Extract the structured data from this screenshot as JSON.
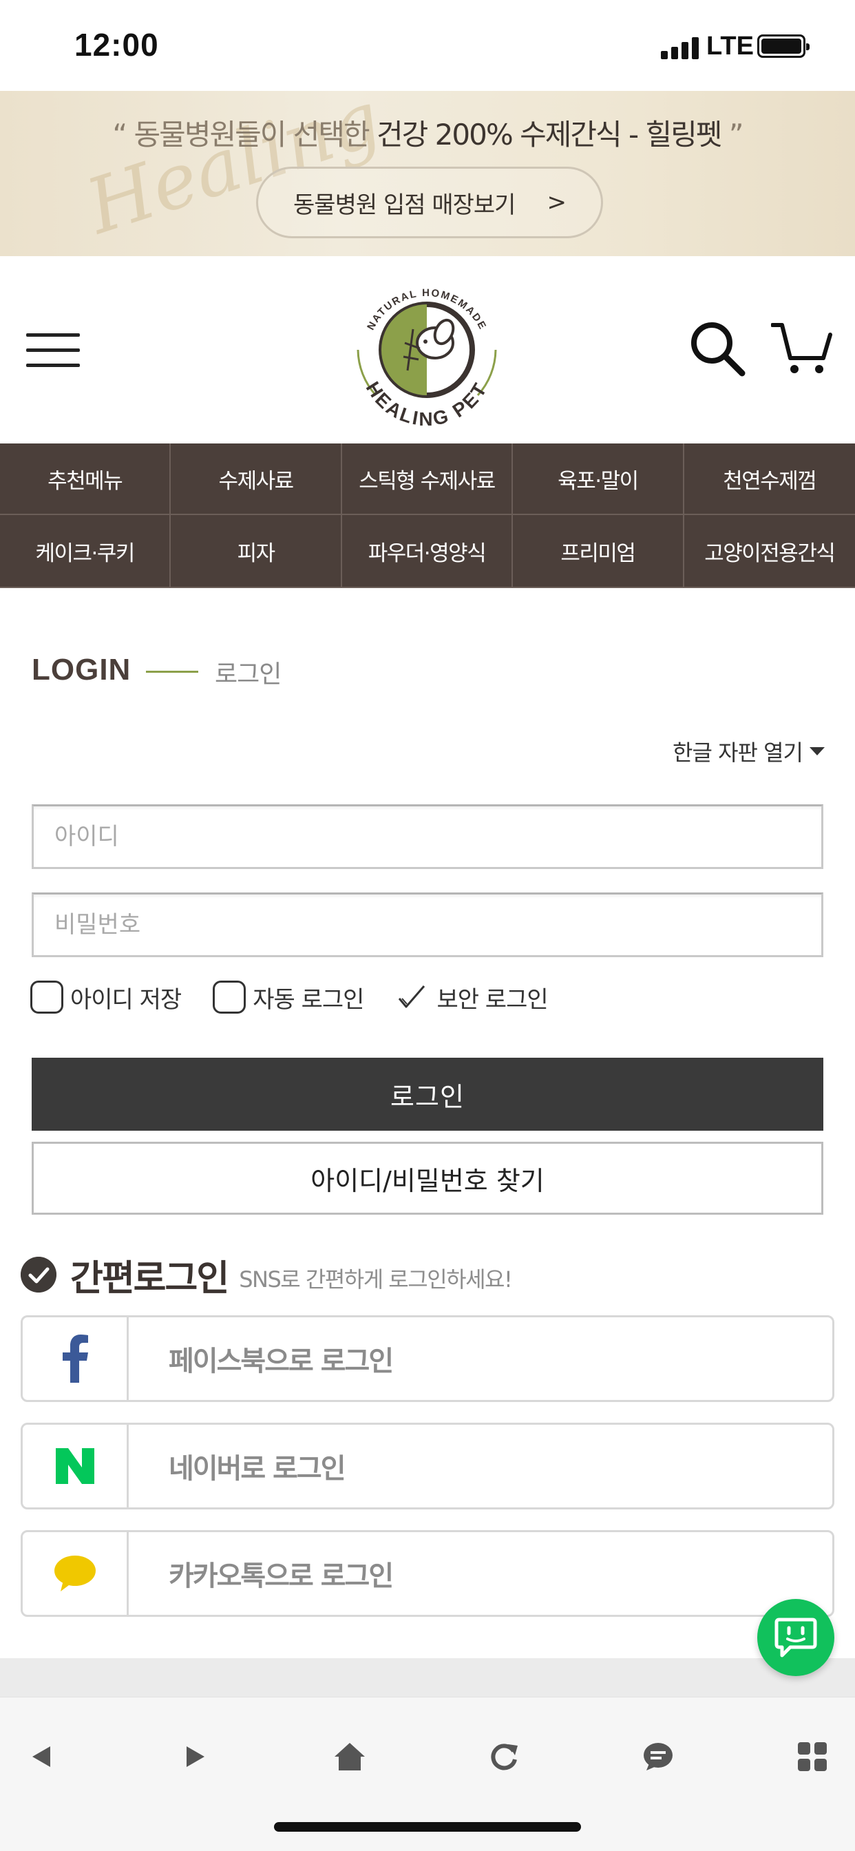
{
  "status_bar": {
    "time": "12:00",
    "network": "LTE"
  },
  "banner": {
    "quote_open": "“",
    "text_light": "동물병원들이 선택한",
    "text_bold": "건강 200% 수제간식 - 힐링펫",
    "quote_close": "”",
    "button_label": "동물병원 입점 매장보기",
    "button_arrow": ">"
  },
  "header": {
    "logo_top_text": "NATURAL HOMEMADE",
    "logo_bottom_text": "HEALING PET"
  },
  "categories": [
    "추천메뉴",
    "수제사료",
    "스틱형 수제사료",
    "육포·말이",
    "천연수제껌",
    "케이크·쿠키",
    "피자",
    "파우더·영양식",
    "프리미엄",
    "고양이전용간식"
  ],
  "login": {
    "title": "LOGIN",
    "subtitle": "로그인",
    "keyboard_toggle": "한글 자판 열기",
    "id_placeholder": "아이디",
    "password_placeholder": "비밀번호",
    "save_id_label": "아이디 저장",
    "auto_login_label": "자동 로그인",
    "secure_login_label": "보안 로그인",
    "login_button": "로그인",
    "find_button": "아이디/비밀번호 찾기"
  },
  "sns": {
    "title": "간편로그인",
    "description": "SNS로 간편하게 로그인하세요!",
    "facebook_label": "페이스북으로 로그인",
    "naver_label": "네이버로 로그인",
    "kakao_label": "카카오톡으로 로그인"
  },
  "colors": {
    "nav_bg": "#4b3f3a",
    "accent_green": "#8ca04a",
    "login_button_bg": "#3a3a3a",
    "facebook": "#3b5998",
    "naver": "#03c75a",
    "kakao": "#f0c800",
    "chat_fab": "#11c15c"
  },
  "toolbar_icons": [
    "back-icon",
    "forward-icon",
    "home-icon",
    "reload-icon",
    "chat-icon",
    "apps-icon"
  ]
}
